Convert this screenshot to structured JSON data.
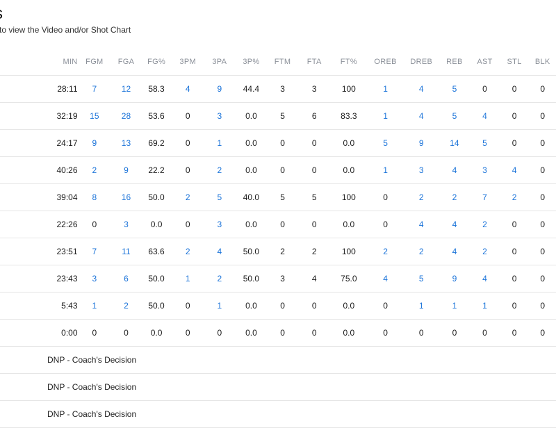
{
  "header": {
    "title": "s",
    "subtitle": "to view the Video and/or Shot Chart"
  },
  "columns": [
    "MIN",
    "FGM",
    "FGA",
    "FG%",
    "3PM",
    "3PA",
    "3P%",
    "FTM",
    "FTA",
    "FT%",
    "OREB",
    "DREB",
    "REB",
    "AST",
    "STL",
    "BLK"
  ],
  "link_columns": [
    1,
    2,
    4,
    5,
    10,
    11,
    12,
    13,
    14
  ],
  "colors": {
    "link": "#1a73d9",
    "header_text": "#8a8f98",
    "divider": "#e6e6e6"
  },
  "rows": [
    [
      "28:11",
      "7",
      "12",
      "58.3",
      "4",
      "9",
      "44.4",
      "3",
      "3",
      "100",
      "1",
      "4",
      "5",
      "0",
      "0",
      "0"
    ],
    [
      "32:19",
      "15",
      "28",
      "53.6",
      "0",
      "3",
      "0.0",
      "5",
      "6",
      "83.3",
      "1",
      "4",
      "5",
      "4",
      "0",
      "0"
    ],
    [
      "24:17",
      "9",
      "13",
      "69.2",
      "0",
      "1",
      "0.0",
      "0",
      "0",
      "0.0",
      "5",
      "9",
      "14",
      "5",
      "0",
      "0"
    ],
    [
      "40:26",
      "2",
      "9",
      "22.2",
      "0",
      "2",
      "0.0",
      "0",
      "0",
      "0.0",
      "1",
      "3",
      "4",
      "3",
      "4",
      "0"
    ],
    [
      "39:04",
      "8",
      "16",
      "50.0",
      "2",
      "5",
      "40.0",
      "5",
      "5",
      "100",
      "0",
      "2",
      "2",
      "7",
      "2",
      "0"
    ],
    [
      "22:26",
      "0",
      "3",
      "0.0",
      "0",
      "3",
      "0.0",
      "0",
      "0",
      "0.0",
      "0",
      "4",
      "4",
      "2",
      "0",
      "0"
    ],
    [
      "23:51",
      "7",
      "11",
      "63.6",
      "2",
      "4",
      "50.0",
      "2",
      "2",
      "100",
      "2",
      "2",
      "4",
      "2",
      "0",
      "0"
    ],
    [
      "23:43",
      "3",
      "6",
      "50.0",
      "1",
      "2",
      "50.0",
      "3",
      "4",
      "75.0",
      "4",
      "5",
      "9",
      "4",
      "0",
      "0"
    ],
    [
      "5:43",
      "1",
      "2",
      "50.0",
      "0",
      "1",
      "0.0",
      "0",
      "0",
      "0.0",
      "0",
      "1",
      "1",
      "1",
      "0",
      "0"
    ],
    [
      "0:00",
      "0",
      "0",
      "0.0",
      "0",
      "0",
      "0.0",
      "0",
      "0",
      "0.0",
      "0",
      "0",
      "0",
      "0",
      "0",
      "0"
    ]
  ],
  "dnp_rows": [
    "DNP - Coach's Decision",
    "DNP - Coach's Decision",
    "DNP - Coach's Decision"
  ]
}
